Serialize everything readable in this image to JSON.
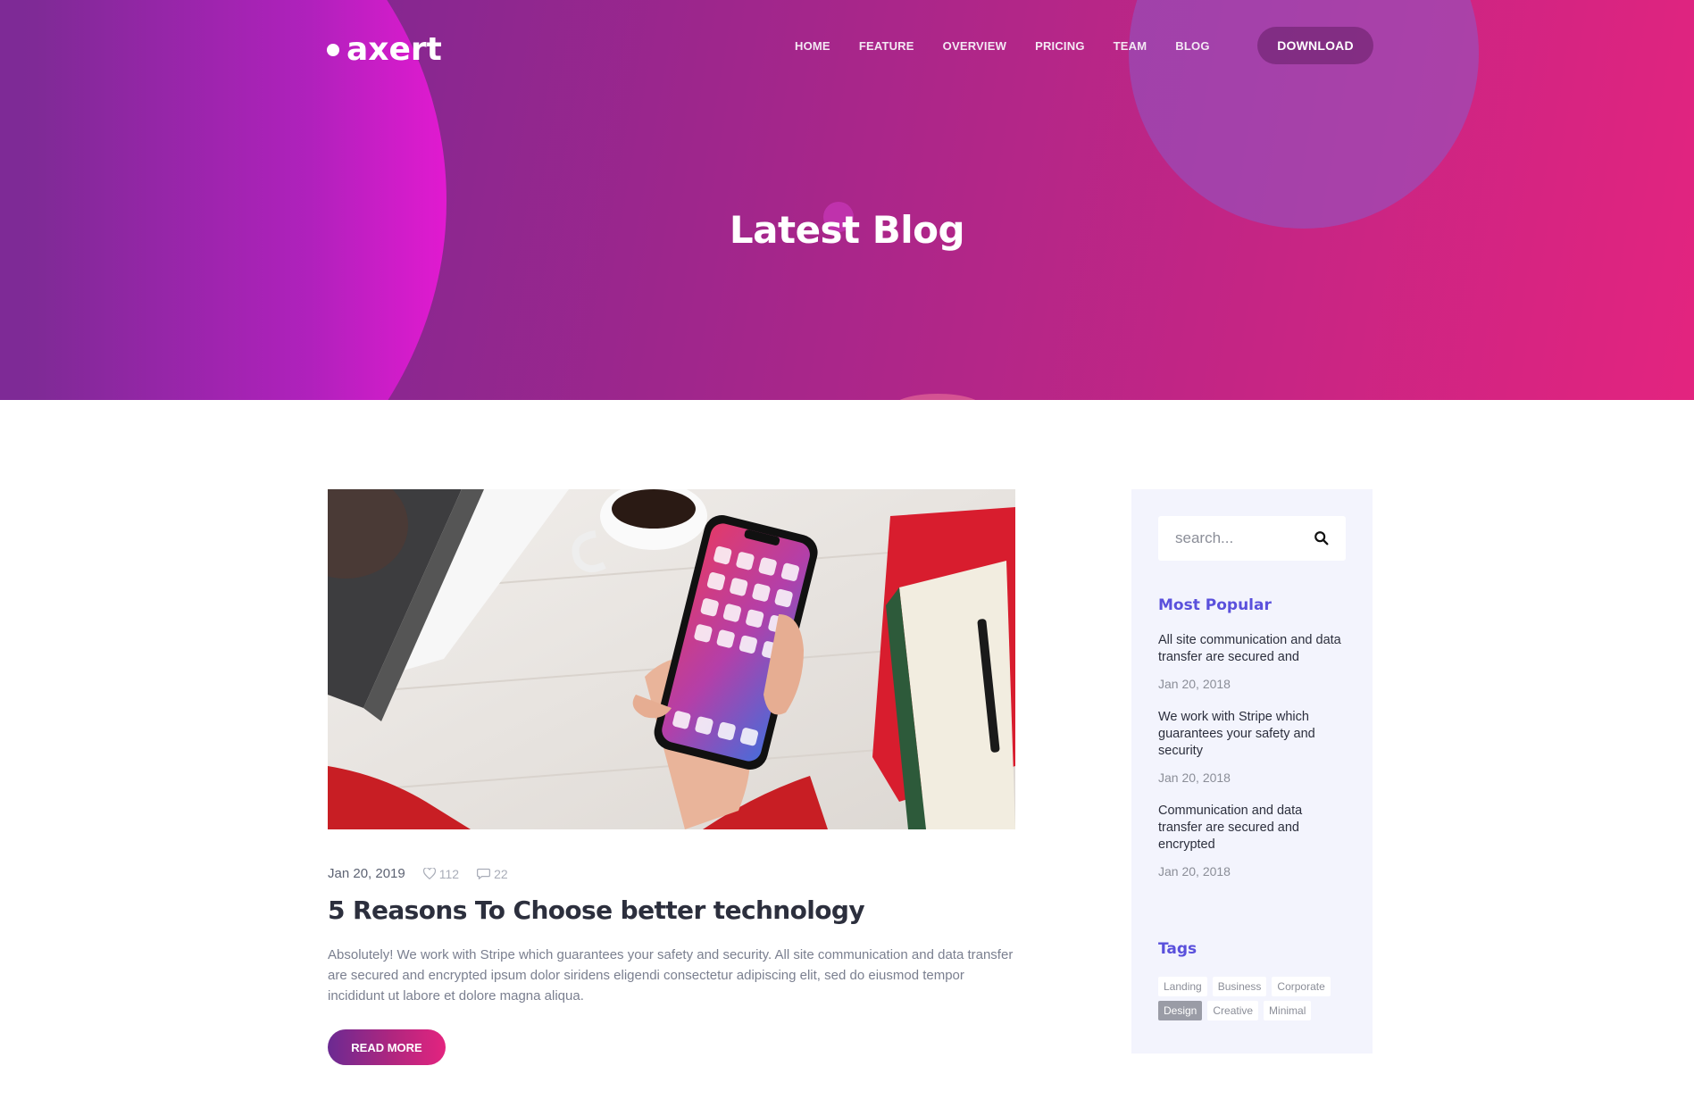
{
  "brand": {
    "logo_text": "axert"
  },
  "nav": {
    "items": [
      "HOME",
      "FEATURE",
      "OVERVIEW",
      "PRICING",
      "TEAM",
      "BLOG"
    ],
    "download_label": "DOWNLOAD"
  },
  "hero": {
    "title": "Latest Blog"
  },
  "post": {
    "image_alt": "Hand holding smartphone over white wooden desk with coffee cup and notebooks",
    "date": "Jan 20, 2019",
    "likes": "112",
    "comments": "22",
    "title": "5 Reasons To Choose better technology",
    "excerpt": "Absolutely! We work with Stripe which guarantees your safety and security. All site communication and data transfer are secured and encrypted ipsum dolor siridens eligendi consectetur adipiscing elit, sed do eiusmod tempor incididunt ut labore et dolore magna aliqua.",
    "read_more_label": "READ MORE"
  },
  "sidebar": {
    "search_placeholder": "search...",
    "popular_heading": "Most Popular",
    "popular": [
      {
        "title": "All site communication and data transfer are secured and",
        "date": "Jan 20, 2018"
      },
      {
        "title": "We work with Stripe which guarantees your safety and security",
        "date": "Jan 20, 2018"
      },
      {
        "title": "Communication and data transfer are secured and encrypted",
        "date": "Jan 20, 2018"
      }
    ],
    "tags_heading": "Tags",
    "tags": [
      "Landing",
      "Business",
      "Corporate",
      "Design",
      "Creative",
      "Minimal"
    ],
    "active_tag": "Design"
  },
  "colors": {
    "hero_gradient_start": "#6b2a92",
    "hero_gradient_end": "#e3247f",
    "accent_heading": "#5a50dc",
    "sidebar_bg": "#f3f4fd"
  }
}
